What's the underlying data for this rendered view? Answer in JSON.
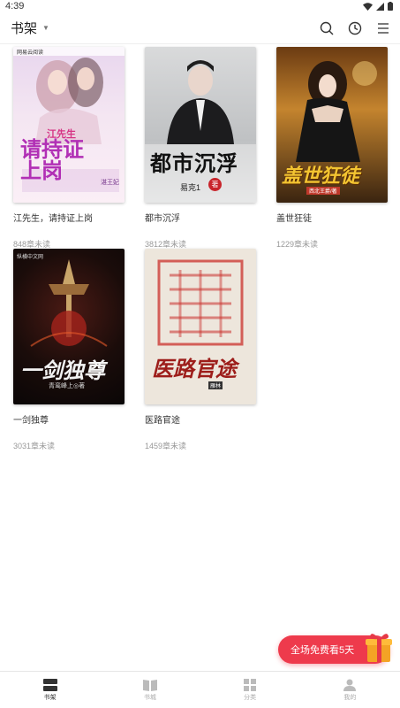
{
  "status_bar": {
    "time": "4:39"
  },
  "header": {
    "title": "书架"
  },
  "books": [
    {
      "title": "江先生，请持证上岗",
      "unread": "848章未读",
      "cover_text": "请持证上岗",
      "cover_sub": "江先生",
      "cover_author": "湛王妃",
      "publisher": "网易云阅读"
    },
    {
      "title": "都市沉浮",
      "unread": "3812章未读",
      "cover_text": "都市沉浮",
      "cover_author": "易克1",
      "cover_badge": "著"
    },
    {
      "title": "盖世狂徒",
      "unread": "1229章未读",
      "cover_text": "盖世狂徒",
      "cover_author": "西北王爵/著"
    },
    {
      "title": "一剑独尊",
      "unread": "3031章未读",
      "cover_text": "一剑独尊",
      "cover_author": "青鸾峰上◎著",
      "publisher": "纵横中文网"
    },
    {
      "title": "医路官途",
      "unread": "1459章未读",
      "cover_text": "医路官途",
      "cover_author": "雁林"
    }
  ],
  "promo": {
    "label": "全场免费看5天"
  },
  "bottom_nav": [
    {
      "label": "书架",
      "icon": "bookshelf-icon"
    },
    {
      "label": "书城",
      "icon": "book-open-icon"
    },
    {
      "label": "分类",
      "icon": "category-grid-icon"
    },
    {
      "label": "我的",
      "icon": "user-icon"
    }
  ],
  "colors": {
    "accent": "#ee3a4c"
  }
}
